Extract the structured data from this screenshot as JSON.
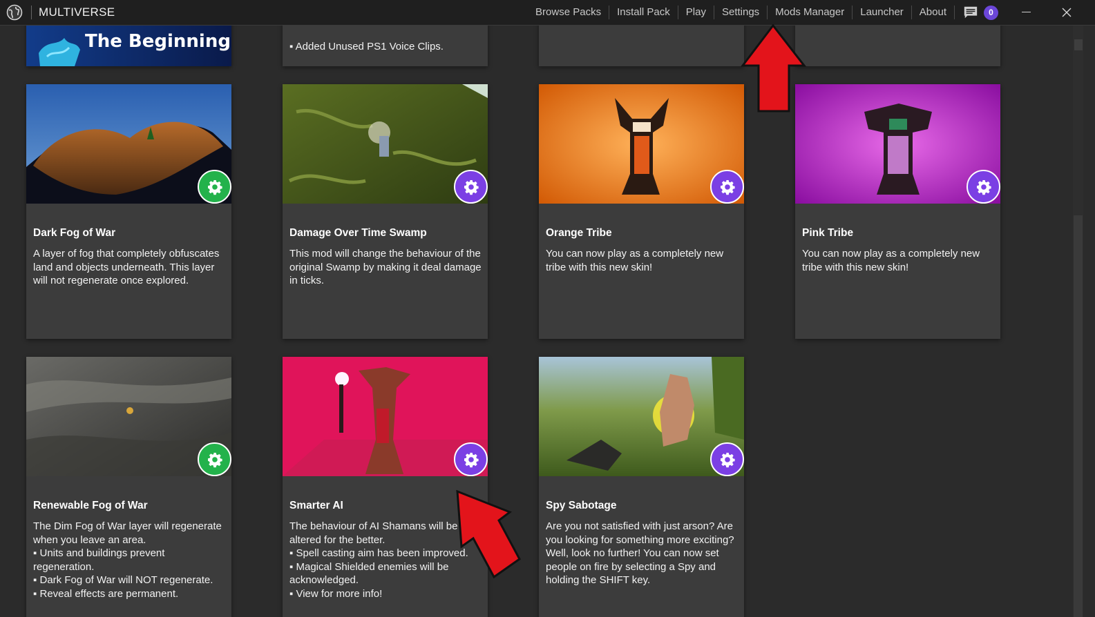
{
  "app": {
    "title": "MULTIVERSE"
  },
  "nav": {
    "items": [
      "Browse Packs",
      "Install Pack",
      "Play",
      "Settings",
      "Mods Manager",
      "Launcher",
      "About"
    ],
    "notification_count": "0"
  },
  "top_row": {
    "banner_text": "The Beginning",
    "note_text": "▪ Added Unused PS1 Voice Clips."
  },
  "cards": [
    {
      "title": "Dark Fog of War",
      "description": "A layer of fog that completely obfuscates land and objects underneath. This layer will not regenerate once explored.",
      "status": "enabled"
    },
    {
      "title": "Damage Over Time Swamp",
      "description": "This mod will change the behaviour of the original Swamp by making it deal damage in ticks.",
      "status": "disabled"
    },
    {
      "title": "Orange Tribe",
      "description": "You can now play as a completely new tribe with this new skin!",
      "status": "disabled"
    },
    {
      "title": "Pink Tribe",
      "description": "You can now play as a completely new tribe with this new skin!",
      "status": "disabled"
    },
    {
      "title": "Renewable Fog of War",
      "description": "The Dim Fog of War layer will regenerate when you leave an area.\n▪ Units and buildings prevent regeneration.\n▪ Dark Fog of War will NOT regenerate.\n▪ Reveal effects are permanent.",
      "status": "enabled"
    },
    {
      "title": "Smarter AI",
      "description": "The behaviour of AI Shamans will be altered for the better.\n▪ Spell casting aim has been improved.\n▪ Magical Shielded enemies will be acknowledged.\n▪ View for more info!",
      "status": "disabled"
    },
    {
      "title": "Spy Sabotage",
      "description": "Are you not satisfied with just arson? Are you looking for something more exciting? Well, look no further! You can now set people on fire by selecting a Spy and holding the SHIFT key.",
      "status": "disabled"
    }
  ],
  "colors": {
    "enabled_gear": "#23b24b",
    "disabled_gear": "#7b3fe4",
    "annotation_arrow": "#e3141b",
    "badge": "#6b46d8"
  }
}
